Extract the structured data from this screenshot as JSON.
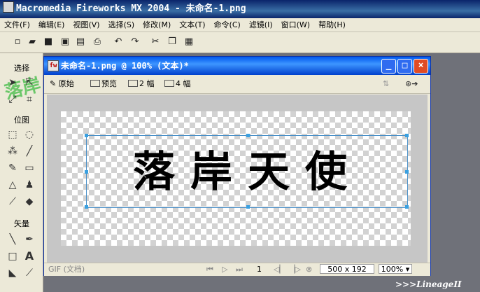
{
  "app": {
    "title": "Macromedia Fireworks MX 2004 - 未命名-1.png"
  },
  "menu": [
    "文件(F)",
    "编辑(E)",
    "视图(V)",
    "选择(S)",
    "修改(M)",
    "文本(T)",
    "命令(C)",
    "滤镜(I)",
    "窗口(W)",
    "帮助(H)"
  ],
  "tools": {
    "logo": "落岸",
    "select_label": "选择",
    "bitmap_label": "位图",
    "vector_label": "矢量"
  },
  "doc": {
    "title": "未命名-1.png @ 100% (文本)*",
    "views": {
      "original": "原始",
      "preview": "预览",
      "two_up": "2 幅",
      "four_up": "4 幅"
    },
    "canvas_text": "落岸天使",
    "status": {
      "format": "GIF (文档)",
      "page": "1",
      "size": "500 x 192",
      "zoom": "100%"
    }
  },
  "watermark": ">>>LineageII",
  "colors": {
    "xp_blue": "#0058ee",
    "close_red": "#e04b24",
    "selection": "#3aa0e0",
    "logo_green": "#5ec45e"
  }
}
